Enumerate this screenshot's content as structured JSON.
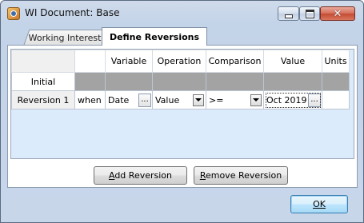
{
  "window": {
    "title": "WI Document: Base"
  },
  "tabs": [
    {
      "label": "Working Interests",
      "active": false
    },
    {
      "label": "Define Reversions",
      "active": true
    }
  ],
  "grid": {
    "columns": [
      "",
      "",
      "Variable",
      "Operation",
      "Comparison",
      "Value",
      "Units"
    ],
    "rows": [
      {
        "header": "Initial",
        "cells": []
      },
      {
        "header": "Reversion 1",
        "when": "when",
        "variable": "Date",
        "operation": "Value",
        "comparison": ">=",
        "value": "Oct 2019",
        "units": ""
      }
    ],
    "ellipsis": "..."
  },
  "buttons": {
    "add_first": "A",
    "add_rest": "dd Reversion",
    "remove_first": "R",
    "remove_rest": "emove Reversion",
    "ok": "OK"
  }
}
